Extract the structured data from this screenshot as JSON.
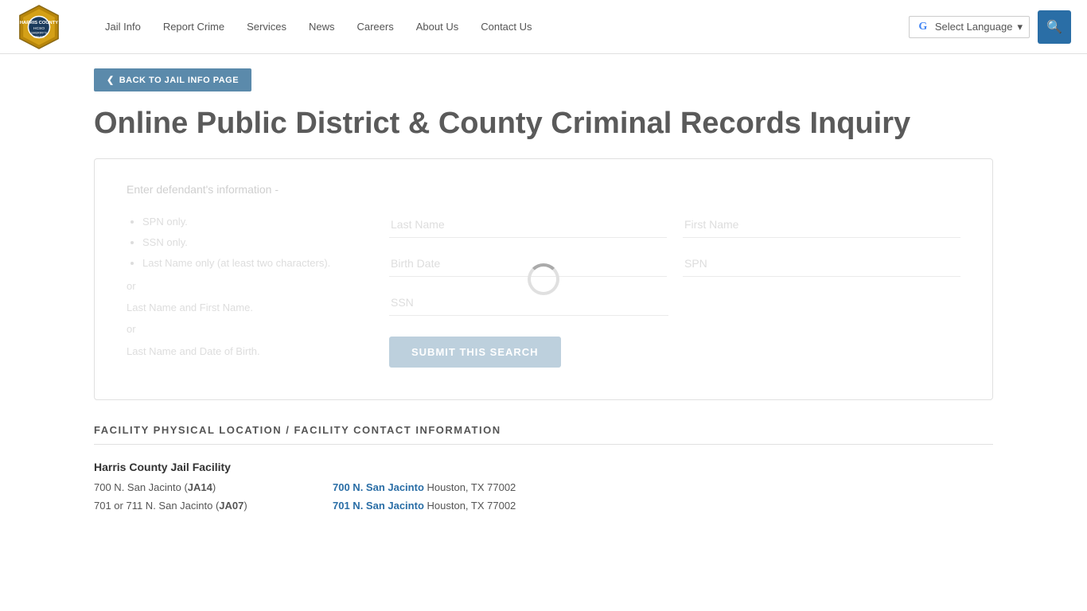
{
  "header": {
    "logo_alt": "Harris County Sheriff's Office",
    "nav_items": [
      {
        "label": "Jail Info",
        "href": "#"
      },
      {
        "label": "Report Crime",
        "href": "#"
      },
      {
        "label": "Services",
        "href": "#"
      },
      {
        "label": "News",
        "href": "#"
      },
      {
        "label": "Careers",
        "href": "#"
      },
      {
        "label": "About Us",
        "href": "#"
      },
      {
        "label": "Contact Us",
        "href": "#"
      }
    ],
    "translate_label": "Select Language",
    "search_icon": "🔍"
  },
  "back_button": "BACK TO JAIL INFO PAGE",
  "page_title": "Online Public District & County Criminal Records Inquiry",
  "form": {
    "instructions": "Enter defendant's information -",
    "bullets": [
      "SPN only.",
      "SSN only.",
      "Last Name only (at least two characters)."
    ],
    "extra_text_1": "or",
    "extra_text_2": "Last Name and First Name.",
    "extra_text_3": "or",
    "extra_text_4": "Last Name and Date of Birth.",
    "last_name_placeholder": "Last Name",
    "first_name_placeholder": "First Name",
    "birth_date_placeholder": "Birth Date",
    "spn_placeholder": "SPN",
    "ssn_placeholder": "SSN",
    "submit_label": "SUBMIT THIS SEARCH"
  },
  "facility": {
    "section_title": "FACILITY PHYSICAL LOCATION / FACILITY CONTACT INFORMATION",
    "name": "Harris County Jail Facility",
    "rows": [
      {
        "left_text": "700 N. San Jacinto (",
        "left_code": "JA14",
        "left_end": ")",
        "right_link": "700 N. San Jacinto",
        "right_extra": " Houston, TX 77002"
      },
      {
        "left_text": "701 or 711 N. San Jacinto (",
        "left_code": "JA07",
        "left_end": ")",
        "right_link": "701 N. San Jacinto",
        "right_extra": " Houston, TX 77002"
      }
    ]
  }
}
